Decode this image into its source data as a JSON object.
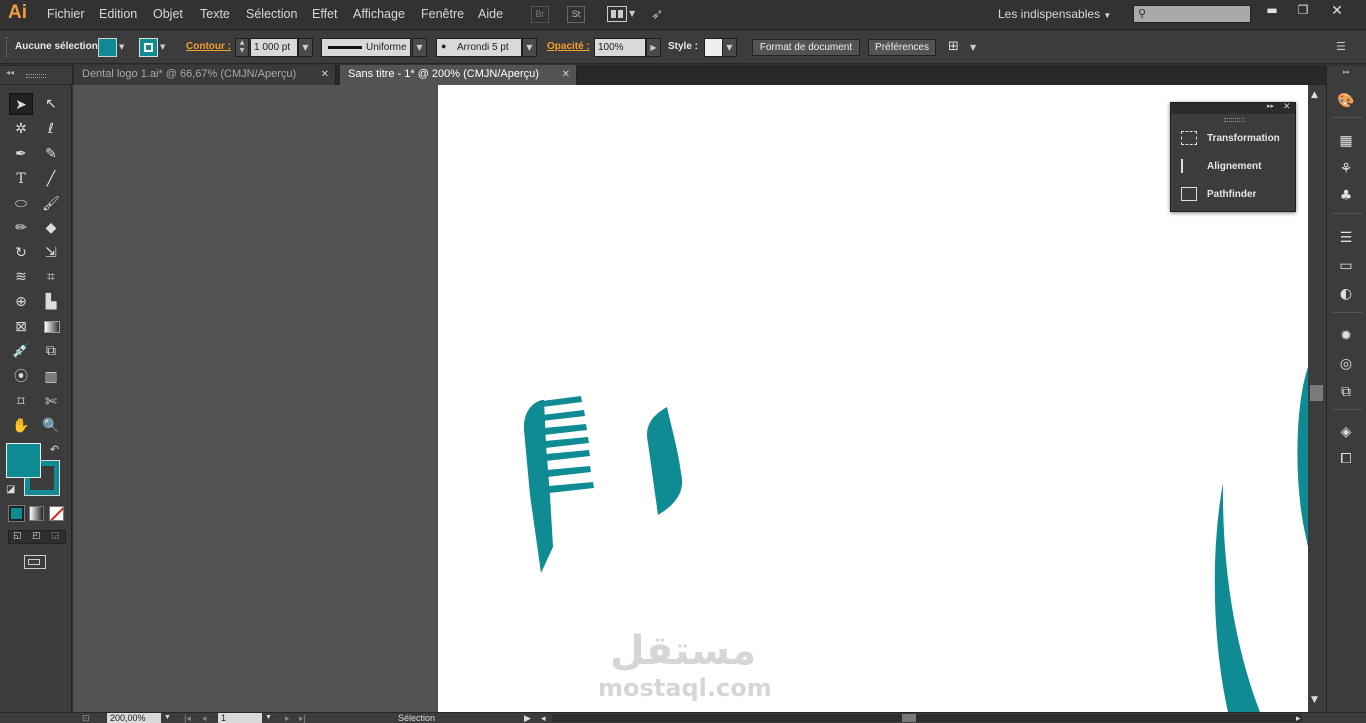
{
  "app": {
    "logo": "Ai",
    "accent": "#f39c3c"
  },
  "menu": [
    "Fichier",
    "Edition",
    "Objet",
    "Texte",
    "Sélection",
    "Effet",
    "Affichage",
    "Fenêtre",
    "Aide"
  ],
  "menubar_icons": {
    "bridge": "Br",
    "stock": "St"
  },
  "workspace": {
    "label": "Les indispensables"
  },
  "search": {
    "value": ""
  },
  "control": {
    "selection": "Aucune sélection",
    "fill_color": "#0e8b93",
    "stroke_label": "Contour :",
    "stroke_weight": "1 000 pt",
    "stroke_profile": "Uniforme",
    "brush": "Arrondi 5 pt",
    "opacity_label": "Opacité :",
    "opacity": "100%",
    "style_label": "Style :",
    "doc_setup_button": "Format de document",
    "prefs_button": "Préférences"
  },
  "tabs": [
    {
      "label": "Dental logo 1.ai* @ 66,67% (CMJN/Aperçu)",
      "active": false
    },
    {
      "label": "Sans titre - 1* @ 200% (CMJN/Aperçu)",
      "active": true
    }
  ],
  "panel": {
    "items": [
      "Transformation",
      "Alignement",
      "Pathfinder"
    ]
  },
  "status": {
    "zoom": "200,00%",
    "page": "1",
    "tool": "Sélection"
  },
  "artwork": {
    "color": "#0e8b93"
  },
  "watermark": {
    "arabic": "مستقل",
    "latin": "mostaql.com"
  }
}
